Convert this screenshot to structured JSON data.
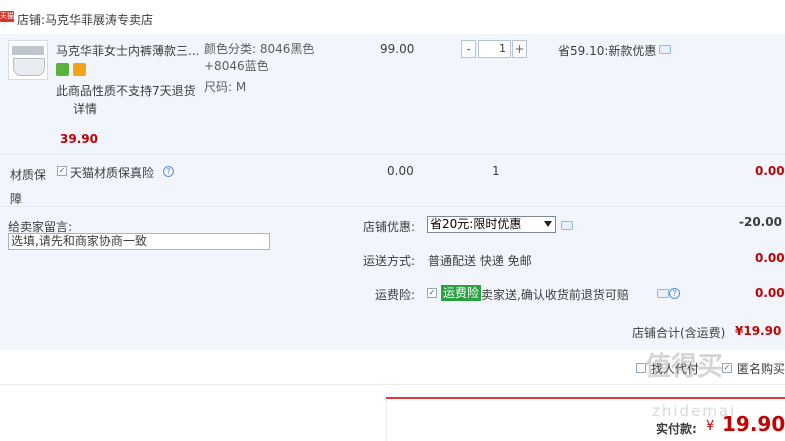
{
  "store": {
    "badge": "天猫",
    "label": "店铺:",
    "name": "马克华菲展涛专卖店"
  },
  "item": {
    "name": "马克华菲女士内裤薄款三...",
    "sku_color_label": "颜色分类:",
    "sku_color_value": "8046黑色+8046蓝色",
    "sku_size": "尺码:  M",
    "no_return_note": "此商品性质不支持7天退货",
    "details_link": "详情",
    "price": "39.90",
    "unit_price": "99.00",
    "quantity": "1",
    "qty_minus": "-",
    "qty_plus": "+",
    "promo": "省59.10:新款优惠"
  },
  "insurance": {
    "label": "材质保障",
    "name": "天猫材质保真险",
    "price": "0.00",
    "qty": "1",
    "amount": "0.00"
  },
  "message": {
    "label": "给卖家留言:",
    "placeholder": "选填,请先和商家协商一致"
  },
  "shop_discount": {
    "label": "店铺优惠:",
    "selected": "省20元:限时优惠",
    "amount": "-20.00"
  },
  "shipping": {
    "label": "运送方式:",
    "value": "普通配送 快递 免邮",
    "amount": "0.00"
  },
  "freight_insurance": {
    "label": "运费险:",
    "badge": "运费险",
    "text": "卖家送,确认收货前退货可赔",
    "amount": "0.00"
  },
  "store_total": {
    "label": "店铺合计(含运费)",
    "amount": "¥19.90"
  },
  "options": {
    "proxy_pay": "找人代付",
    "anonymous": "匿名购买"
  },
  "payment": {
    "label": "实付款:",
    "currency": "¥",
    "amount": "19.90"
  },
  "watermark": {
    "line1": "值得买",
    "line2": "zhidemai"
  },
  "colors": {
    "accent_red": "#c40000",
    "row_blue": "#f2f6fc",
    "freight_green": "#2aa040",
    "badge_red": "#d8342c"
  }
}
